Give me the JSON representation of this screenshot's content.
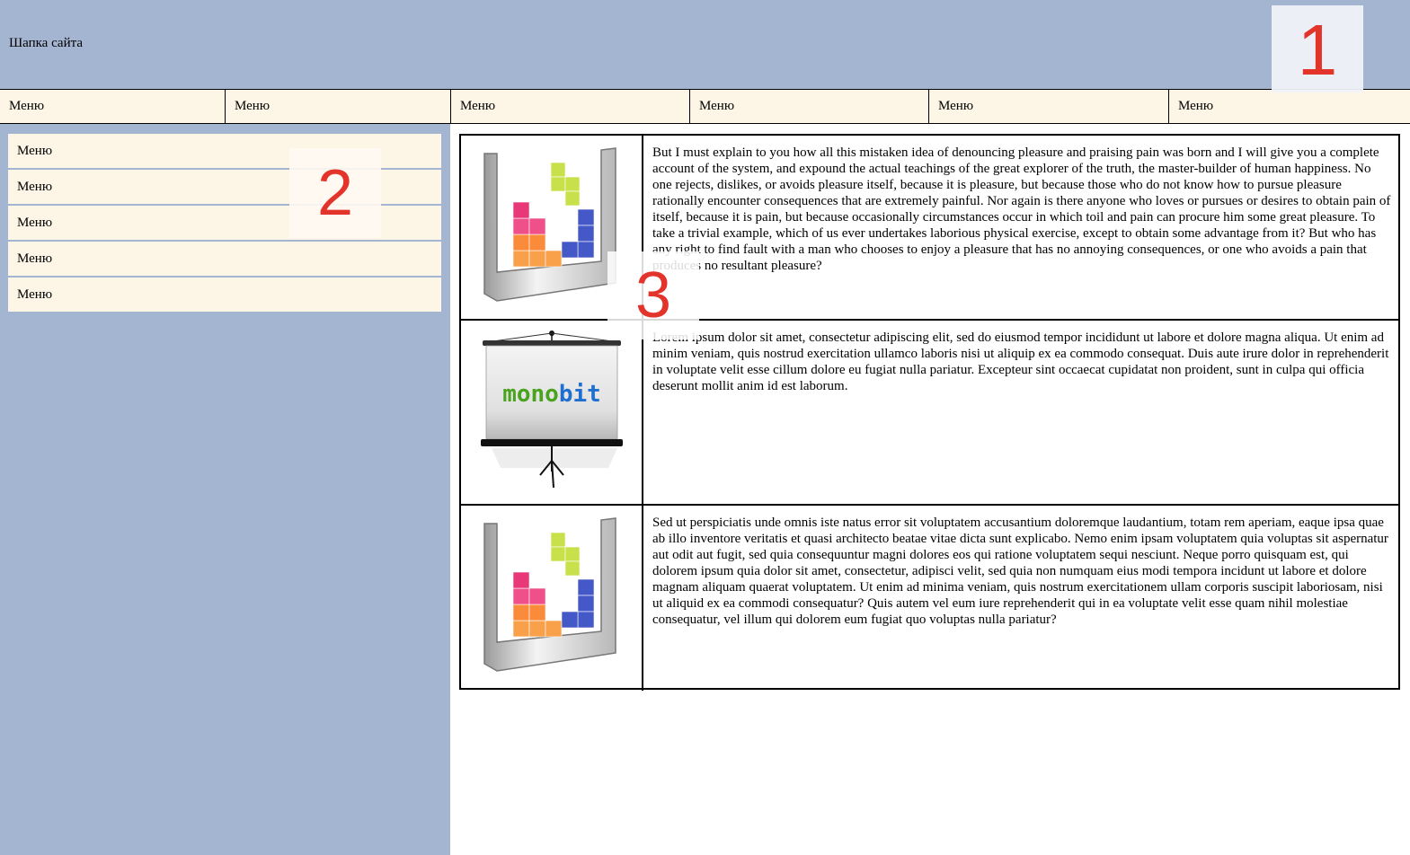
{
  "header": {
    "title": "Шапка сайта",
    "badge": "1"
  },
  "topnav": {
    "items": [
      "Меню",
      "Меню",
      "Меню",
      "Меню",
      "Меню",
      "Меню"
    ]
  },
  "sidebar": {
    "items": [
      "Меню",
      "Меню",
      "Меню",
      "Меню",
      "Меню"
    ],
    "badge": "2"
  },
  "content": {
    "badge": "3",
    "rows": [
      {
        "image_icon": "tetris-blocks-icon",
        "text": "But I must explain to you how all this mistaken idea of denouncing pleasure and praising pain was born and I will give you a complete account of the system, and expound the actual teachings of the great explorer of the truth, the master-builder of human happiness. No one rejects, dislikes, or avoids pleasure itself, because it is pleasure, but because those who do not know how to pursue pleasure rationally encounter consequences that are extremely painful. Nor again is there anyone who loves or pursues or desires to obtain pain of itself, because it is pain, but because occasionally circumstances occur in which toil and pain can procure him some great pleasure. To take a trivial example, which of us ever undertakes laborious physical exercise, except to obtain some advantage from it? But who has any right to find fault with a man who chooses to enjoy a pleasure that has no annoying consequences, or one who avoids a pain that produces no resultant pleasure?"
      },
      {
        "image_icon": "projector-screen-icon",
        "image_logo": "monobit",
        "text": "Lorem ipsum dolor sit amet, consectetur adipiscing elit, sed do eiusmod tempor incididunt ut labore et dolore magna aliqua. Ut enim ad minim veniam, quis nostrud exercitation ullamco laboris nisi ut aliquip ex ea commodo consequat. Duis aute irure dolor in reprehenderit in voluptate velit esse cillum dolore eu fugiat nulla pariatur. Excepteur sint occaecat cupidatat non proident, sunt in culpa qui officia deserunt mollit anim id est laborum."
      },
      {
        "image_icon": "tetris-blocks-icon",
        "text": "Sed ut perspiciatis unde omnis iste natus error sit voluptatem accusantium doloremque laudantium, totam rem aperiam, eaque ipsa quae ab illo inventore veritatis et quasi architecto beatae vitae dicta sunt explicabo. Nemo enim ipsam voluptatem quia voluptas sit aspernatur aut odit aut fugit, sed quia consequuntur magni dolores eos qui ratione voluptatem sequi nesciunt. Neque porro quisquam est, qui dolorem ipsum quia dolor sit amet, consectetur, adipisci velit, sed quia non numquam eius modi tempora incidunt ut labore et dolore magnam aliquam quaerat voluptatem. Ut enim ad minima veniam, quis nostrum exercitationem ullam corporis suscipit laboriosam, nisi ut aliquid ex ea commodi consequatur? Quis autem vel eum iure reprehenderit qui in ea voluptate velit esse quam nihil molestiae consequatur, vel illum qui dolorem eum fugiat quo voluptas nulla pariatur?"
      }
    ]
  },
  "colors": {
    "header_bg": "#a4b5d1",
    "menu_bg": "#fdf5e6",
    "badge_number": "#e3342b"
  }
}
